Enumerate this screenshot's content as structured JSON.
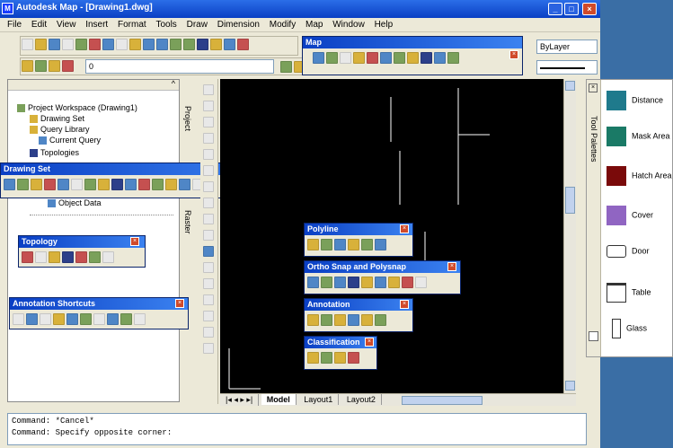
{
  "window": {
    "title": "Autodesk Map - [Drawing1.dwg]"
  },
  "menus": [
    "File",
    "Edit",
    "View",
    "Insert",
    "Format",
    "Tools",
    "Draw",
    "Dimension",
    "Modify",
    "Map",
    "Window",
    "Help"
  ],
  "toolbar": {
    "layer_combo": "0",
    "map_toolbar_title": "Map",
    "linetype_combo": "ByLayer"
  },
  "workspace": {
    "tabs": [
      "Project",
      "Raster"
    ],
    "tree": [
      "Project Workspace (Drawing1)",
      "Drawing Set",
      "Query Library",
      "Current Query",
      "Topologies",
      "Object Data"
    ],
    "float_title": "Drawing Set",
    "topology_title": "Topology",
    "annotation_title": "Annotation Shortcuts"
  },
  "floating_toolbars": {
    "polyline": "Polyline",
    "ortho": "Ortho Snap and Polysnap",
    "annotation": "Annotation",
    "classification": "Classification"
  },
  "layout_tabs": [
    "Model",
    "Layout1",
    "Layout2"
  ],
  "command_line": [
    "Command: *Cancel*",
    "Command:  Specify opposite corner:"
  ],
  "palette": {
    "items": [
      {
        "label": "Distance",
        "color": "#1f7a8c"
      },
      {
        "label": "Mask Area",
        "color": "#1a7a66"
      },
      {
        "label": "Hatch Area",
        "color": "#7a0a0a"
      },
      {
        "label": "Cover",
        "color": "#9065c2"
      },
      {
        "label": "Door",
        "color": ""
      },
      {
        "label": "Table",
        "color": ""
      },
      {
        "label": "Glass",
        "color": ""
      }
    ],
    "side_label": "Tool Palettes"
  }
}
